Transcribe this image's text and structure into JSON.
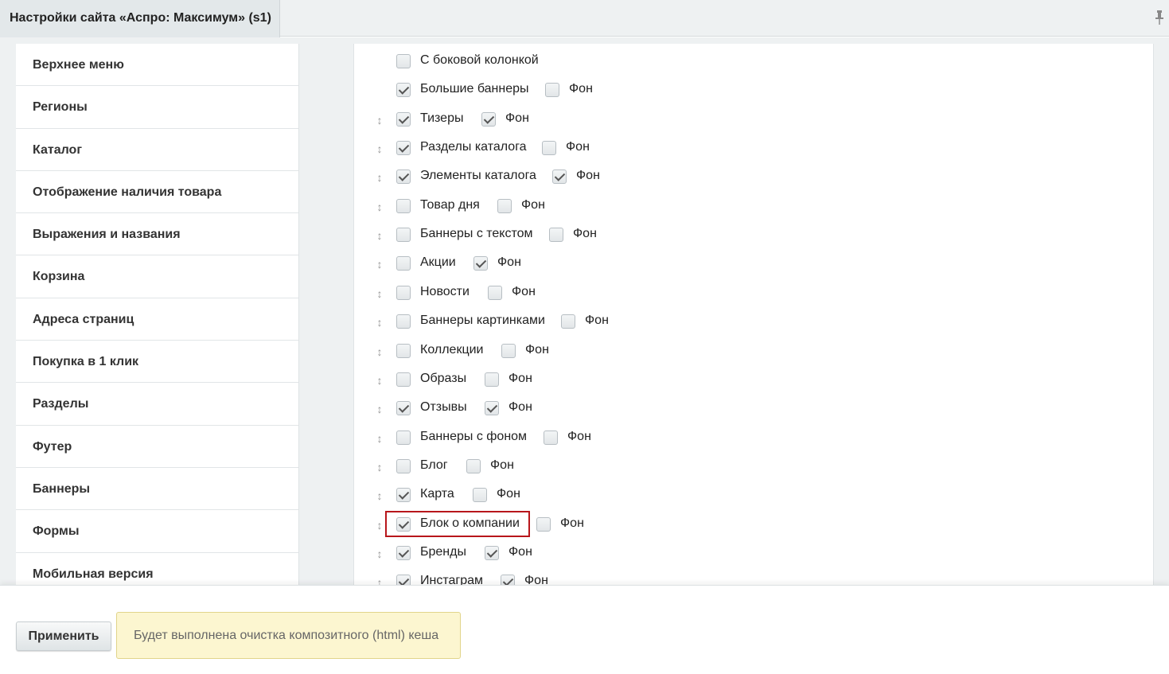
{
  "header": {
    "tab_title": "Настройки сайта «Аспро: Максимум» (s1)"
  },
  "sidebar": {
    "items": [
      {
        "label": "Верхнее меню"
      },
      {
        "label": "Регионы"
      },
      {
        "label": "Каталог"
      },
      {
        "label": "Отображение наличия товара"
      },
      {
        "label": "Выражения и названия"
      },
      {
        "label": "Корзина"
      },
      {
        "label": "Адреса страниц"
      },
      {
        "label": "Покупка в 1 клик"
      },
      {
        "label": "Разделы"
      },
      {
        "label": "Футер"
      },
      {
        "label": "Баннеры"
      },
      {
        "label": "Формы"
      },
      {
        "label": "Мобильная версия"
      }
    ]
  },
  "blocks": {
    "bg_label": "Фон",
    "rows": [
      {
        "label": "С боковой колонкой",
        "checked": false,
        "has_bg": false,
        "bg_checked": false,
        "draggable": false
      },
      {
        "label": "Большие баннеры",
        "checked": true,
        "has_bg": true,
        "bg_checked": false,
        "draggable": false
      },
      {
        "label": "Тизеры",
        "checked": true,
        "has_bg": true,
        "bg_checked": true,
        "draggable": true
      },
      {
        "label": "Разделы каталога",
        "checked": true,
        "has_bg": true,
        "bg_checked": false,
        "draggable": true
      },
      {
        "label": "Элементы каталога",
        "checked": true,
        "has_bg": true,
        "bg_checked": true,
        "draggable": true
      },
      {
        "label": "Товар дня",
        "checked": false,
        "has_bg": true,
        "bg_checked": false,
        "draggable": true
      },
      {
        "label": "Баннеры с текстом",
        "checked": false,
        "has_bg": true,
        "bg_checked": false,
        "draggable": true
      },
      {
        "label": "Акции",
        "checked": false,
        "has_bg": true,
        "bg_checked": true,
        "draggable": true
      },
      {
        "label": "Новости",
        "checked": false,
        "has_bg": true,
        "bg_checked": false,
        "draggable": true
      },
      {
        "label": "Баннеры картинками",
        "checked": false,
        "has_bg": true,
        "bg_checked": false,
        "draggable": true
      },
      {
        "label": "Коллекции",
        "checked": false,
        "has_bg": true,
        "bg_checked": false,
        "draggable": true
      },
      {
        "label": "Образы",
        "checked": false,
        "has_bg": true,
        "bg_checked": false,
        "draggable": true
      },
      {
        "label": "Отзывы",
        "checked": true,
        "has_bg": true,
        "bg_checked": true,
        "draggable": true
      },
      {
        "label": "Баннеры с фоном",
        "checked": false,
        "has_bg": true,
        "bg_checked": false,
        "draggable": true
      },
      {
        "label": "Блог",
        "checked": false,
        "has_bg": true,
        "bg_checked": false,
        "draggable": true
      },
      {
        "label": "Карта",
        "checked": true,
        "has_bg": true,
        "bg_checked": false,
        "draggable": true
      },
      {
        "label": "Блок о компании",
        "checked": true,
        "has_bg": true,
        "bg_checked": false,
        "draggable": true,
        "highlighted": true
      },
      {
        "label": "Бренды",
        "checked": true,
        "has_bg": true,
        "bg_checked": true,
        "draggable": true
      },
      {
        "label": "Инстаграм",
        "checked": true,
        "has_bg": true,
        "bg_checked": true,
        "draggable": true
      }
    ]
  },
  "footer": {
    "apply_label": "Применить",
    "note_text": "Будет выполнена очистка композитного (html) кеша"
  },
  "colors": {
    "highlight_border": "#b8161b",
    "note_background": "#fcf6d0"
  }
}
